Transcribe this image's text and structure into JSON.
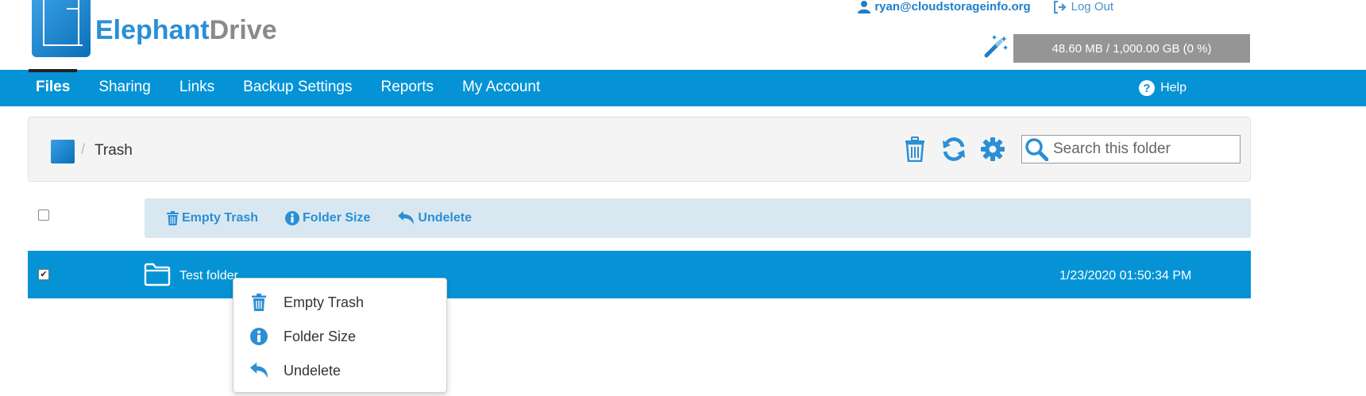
{
  "header": {
    "brand_part1": "Elephant",
    "brand_part2": "Drive",
    "user_email": "ryan@cloudstorageinfo.org",
    "logout_label": "Log Out",
    "quota_text": "48.60 MB / 1,000.00 GB (0 %)"
  },
  "nav": {
    "items": [
      {
        "label": "Files",
        "active": true
      },
      {
        "label": "Sharing"
      },
      {
        "label": "Links"
      },
      {
        "label": "Backup Settings"
      },
      {
        "label": "Reports"
      },
      {
        "label": "My Account"
      }
    ],
    "help_label": "Help"
  },
  "breadcrumb": {
    "separator": "/",
    "current": "Trash"
  },
  "search": {
    "placeholder": "Search this folder"
  },
  "actions": {
    "empty_trash": "Empty Trash",
    "folder_size": "Folder Size",
    "undelete": "Undelete"
  },
  "files": [
    {
      "name": "Test folder",
      "date": "1/23/2020 01:50:34 PM",
      "checked": true,
      "check_mark": "✔"
    }
  ],
  "context_menu": {
    "items": [
      {
        "label": "Empty Trash",
        "icon": "trash-icon"
      },
      {
        "label": "Folder Size",
        "icon": "info-icon"
      },
      {
        "label": "Undelete",
        "icon": "undo-icon"
      }
    ]
  },
  "colors": {
    "primary": "#0593d6",
    "link": "#2a8fd6",
    "quota_bg": "#959595",
    "actionbar_bg": "#d9e8f0"
  }
}
